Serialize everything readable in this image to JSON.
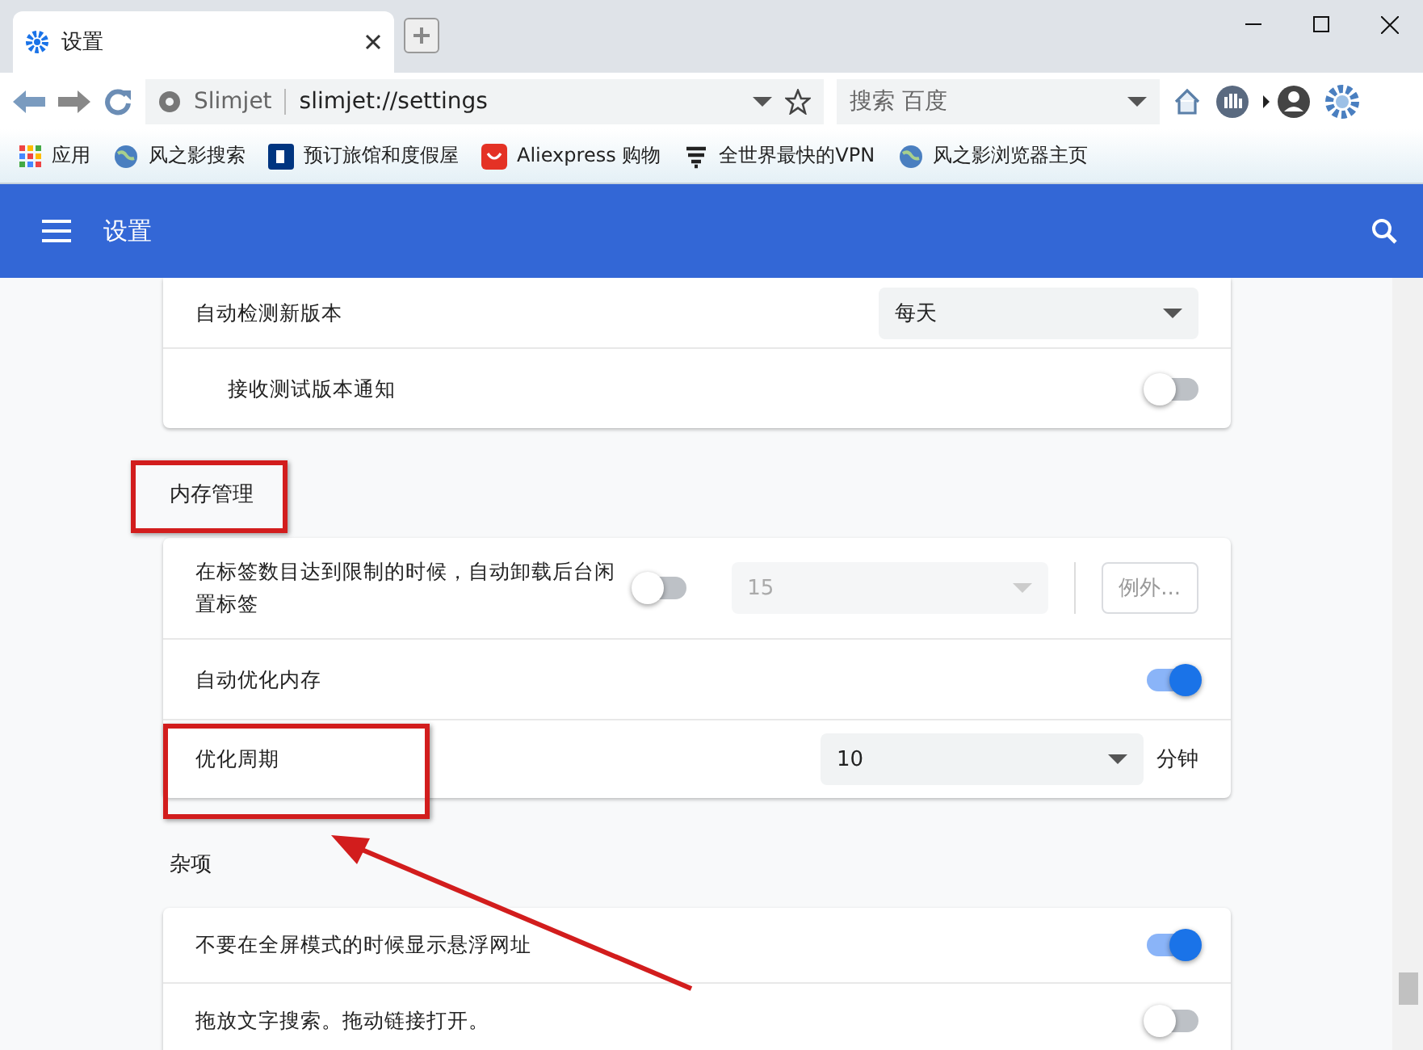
{
  "tab": {
    "title": "设置"
  },
  "toolbar": {
    "site_label": "Slimjet",
    "url": "slimjet://settings",
    "search_placeholder": "搜索 百度"
  },
  "bookmarks": [
    {
      "label": "应用"
    },
    {
      "label": "风之影搜索"
    },
    {
      "label": "预订旅馆和度假屋"
    },
    {
      "label": "Aliexpress 购物"
    },
    {
      "label": "全世界最快的VPN"
    },
    {
      "label": "风之影浏览器主页"
    }
  ],
  "header": {
    "title": "设置"
  },
  "sections": [
    {
      "rows": [
        {
          "kind": "select",
          "label": "自动检测新版本",
          "value": "每天"
        },
        {
          "kind": "toggle",
          "label": "接收测试版本通知",
          "on": false,
          "indented": true
        }
      ]
    },
    {
      "heading": "内存管理",
      "rows": [
        {
          "kind": "toggle-select-button",
          "label": "在标签数目达到限制的时候，自动卸载后台闲置标签",
          "on": false,
          "value": "15",
          "disabled": true,
          "button": "例外..."
        },
        {
          "kind": "toggle",
          "label": "自动优化内存",
          "on": true
        },
        {
          "kind": "select-unit",
          "label": "优化周期",
          "value": "10",
          "unit": "分钟"
        }
      ]
    },
    {
      "heading": "杂项",
      "rows": [
        {
          "kind": "toggle",
          "label": "不要在全屏模式的时候显示悬浮网址",
          "on": true
        },
        {
          "kind": "toggle",
          "label": "拖放文字搜索。拖动链接打开。",
          "on": false
        }
      ]
    }
  ]
}
